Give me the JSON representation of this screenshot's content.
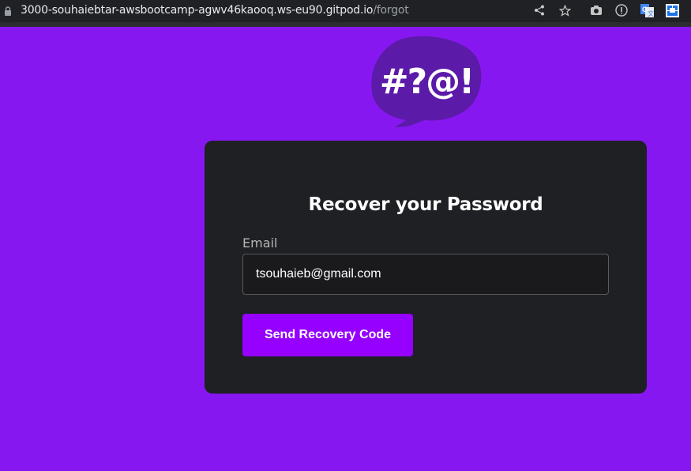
{
  "browser": {
    "url_host": "3000-souhaiebtar-awsbootcamp-agwv46kaooq.ws-eu90.gitpod.io",
    "url_path": "/forgot",
    "icons": [
      "lock-icon",
      "share-icon",
      "star-icon",
      "camera-icon",
      "info-icon",
      "translate-icon",
      "extension-icon"
    ]
  },
  "logo": {
    "text": "#?@!",
    "colors": {
      "bubble": "#5b1aa8",
      "text": "#ffffff"
    }
  },
  "form": {
    "title": "Recover your Password",
    "email_label": "Email",
    "email_value": "tsouhaieb@gmail.com",
    "submit_label": "Send Recovery Code"
  },
  "colors": {
    "page_background": "#8717f0",
    "card_background": "#1f2023",
    "button_background": "#9500ff"
  }
}
